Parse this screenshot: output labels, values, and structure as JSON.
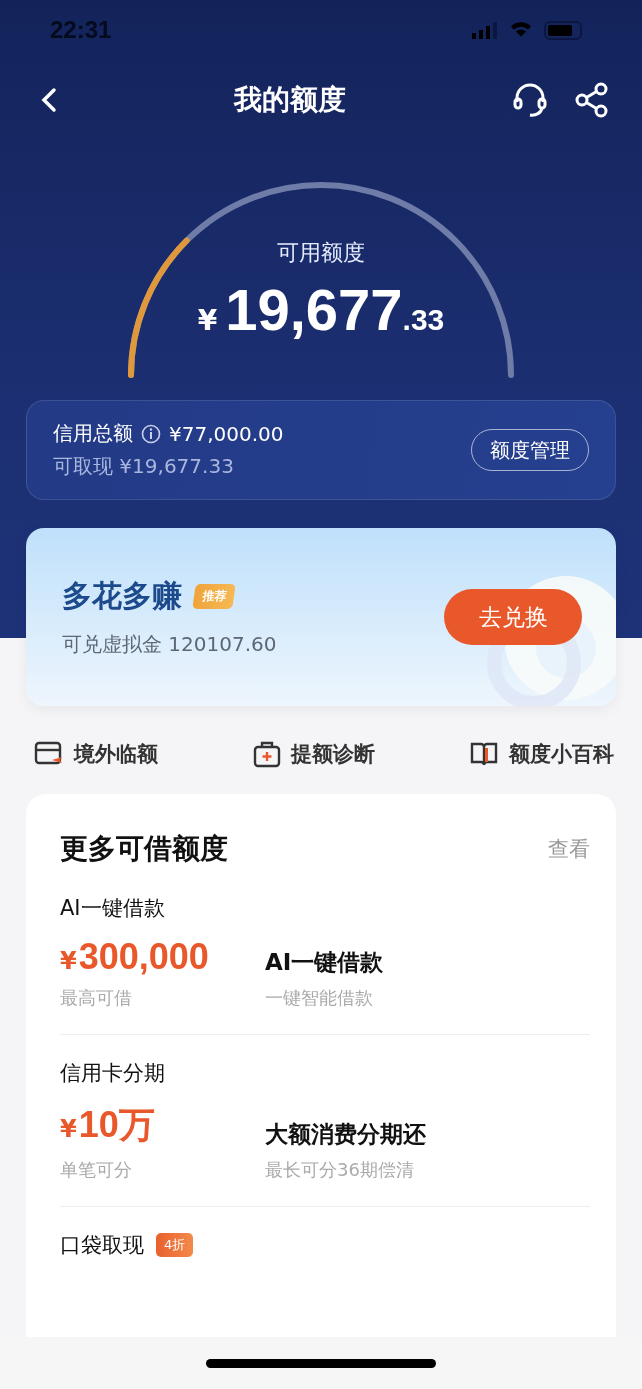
{
  "status_bar": {
    "time": "22:31"
  },
  "nav": {
    "title": "我的额度"
  },
  "gauge": {
    "label": "可用额度",
    "currency": "¥",
    "integer": "19,677",
    "decimal": ".33"
  },
  "credit": {
    "total_label": "信用总额",
    "total_value": "¥77,000.00",
    "cash": "可取现 ¥19,677.33",
    "button": "额度管理"
  },
  "promo": {
    "title": "多花多赚",
    "badge": "推荐",
    "subtitle": "可兑虚拟金 120107.60",
    "button": "去兑换"
  },
  "shortcuts": [
    {
      "kind": "overseas",
      "label": "境外临额"
    },
    {
      "kind": "diagnosis",
      "label": "提额诊断"
    },
    {
      "kind": "book",
      "label": "额度小百科"
    }
  ],
  "more": {
    "title": "更多可借额度",
    "link": "查看",
    "items": [
      {
        "title": "AI一键借款",
        "currency": "¥",
        "amount": "300,000",
        "amount_label": "最高可借",
        "feature_title": "AI一键借款",
        "feature_subtitle": "一键智能借款"
      },
      {
        "title": "信用卡分期",
        "currency": "¥",
        "amount": "10万",
        "amount_label": "单笔可分",
        "feature_title": "大额消费分期还",
        "feature_subtitle": "最长可分36期偿清"
      },
      {
        "title": "口袋取现",
        "badge": "4折"
      }
    ]
  }
}
